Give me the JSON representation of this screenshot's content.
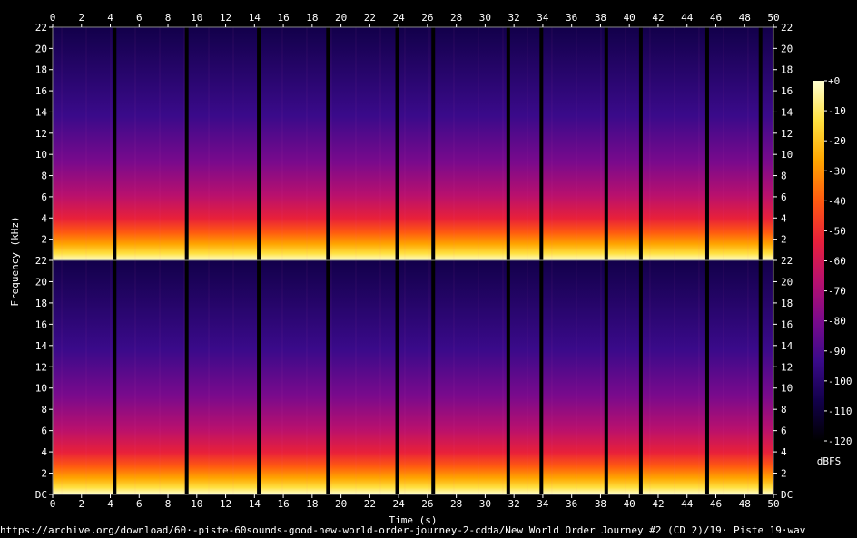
{
  "chart_data": {
    "type": "heatmap",
    "subtype": "spectrogram",
    "channels": 2,
    "xlabel": "Time (s)",
    "ylabel": "Frequency (kHz)",
    "x_ticks": [
      0,
      2,
      4,
      6,
      8,
      10,
      12,
      14,
      16,
      18,
      20,
      22,
      24,
      26,
      28,
      30,
      32,
      34,
      36,
      38,
      40,
      42,
      44,
      46,
      48,
      50
    ],
    "xlim": [
      0,
      50
    ],
    "y_ticks": [
      "DC",
      "2",
      "4",
      "6",
      "8",
      "10",
      "12",
      "14",
      "16",
      "18",
      "20",
      "22"
    ],
    "ylim_khz": [
      0,
      22
    ],
    "colorbar": {
      "label": "dBFS",
      "ticks": [
        "+0",
        "-10",
        "-20",
        "-30",
        "-40",
        "-50",
        "-60",
        "-70",
        "-80",
        "-90",
        "-100",
        "-110",
        "-120"
      ],
      "range": [
        -120,
        0
      ]
    },
    "silent_gaps_s": [
      4.3,
      9.3,
      14.3,
      19.1,
      23.9,
      26.4,
      31.6,
      33.9,
      38.4,
      40.8,
      45.4,
      49.1
    ],
    "colormap": [
      "#000000",
      "#12004a",
      "#3a0a8a",
      "#7a0a8c",
      "#b8106e",
      "#e8203a",
      "#ff5a10",
      "#ffa500",
      "#ffe040",
      "#ffffd0"
    ]
  },
  "caption": "https://archive.org/download/60·-piste-60sounds-good-new-world-order-journey-2-cdda/New World Order Journey #2 (CD 2)/19· Piste 19·wav"
}
